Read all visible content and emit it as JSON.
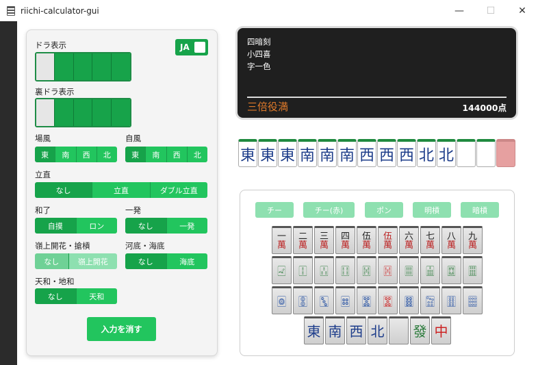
{
  "window": {
    "title": "riichi-calculator-gui",
    "minimize": "—",
    "maximize": "☐",
    "close": "✕"
  },
  "left": {
    "dora_label": "ドラ表示",
    "ura_label": "裏ドラ表示",
    "lang": "JA",
    "bakaze_label": "場風",
    "jikaze_label": "自風",
    "winds": [
      "東",
      "南",
      "西",
      "北"
    ],
    "riichi_label": "立直",
    "riichi_opts": [
      "なし",
      "立直",
      "ダブル立直"
    ],
    "agari_label": "和了",
    "agari_opts": [
      "自摸",
      "ロン"
    ],
    "ippatsu_label": "一発",
    "ippatsu_opts": [
      "なし",
      "一発"
    ],
    "rinshan_label": "嶺上開花・搶槓",
    "rinshan_opts": [
      "なし",
      "嶺上開花"
    ],
    "haitei_label": "河底・海底",
    "haitei_opts": [
      "なし",
      "海底"
    ],
    "tenhou_label": "天和・地和",
    "tenhou_opts": [
      "なし",
      "天和"
    ],
    "clear_label": "入力を消す"
  },
  "result": {
    "yaku": [
      "四暗刻",
      "小四喜",
      "字一色"
    ],
    "rank": "三倍役満",
    "points": "144000点"
  },
  "hand": [
    "東",
    "東",
    "東",
    "南",
    "南",
    "南",
    "西",
    "西",
    "西",
    "北",
    "北",
    "",
    "",
    ""
  ],
  "palette": {
    "melds": [
      "チー",
      "チー(赤)",
      "ポン",
      "明槓",
      "暗槓"
    ],
    "man_top": [
      "一",
      "二",
      "三",
      "四",
      "伍",
      "伍",
      "六",
      "七",
      "八",
      "九"
    ],
    "man_bottom": "萬",
    "sou": [
      "🀐",
      "🀑",
      "🀒",
      "🀓",
      "🀔",
      "🀔",
      "🀕",
      "🀖",
      "🀗",
      "🀘"
    ],
    "pin": [
      "🀙",
      "🀚",
      "🀛",
      "🀜",
      "🀝",
      "🀝",
      "🀞",
      "🀟",
      "🀠",
      "🀡"
    ],
    "honors": [
      "東",
      "南",
      "西",
      "北",
      "",
      "發",
      "中"
    ]
  },
  "colors": {
    "accent": "#22c55e",
    "accent_dark": "#16a34a",
    "rank": "#e07a2a"
  }
}
